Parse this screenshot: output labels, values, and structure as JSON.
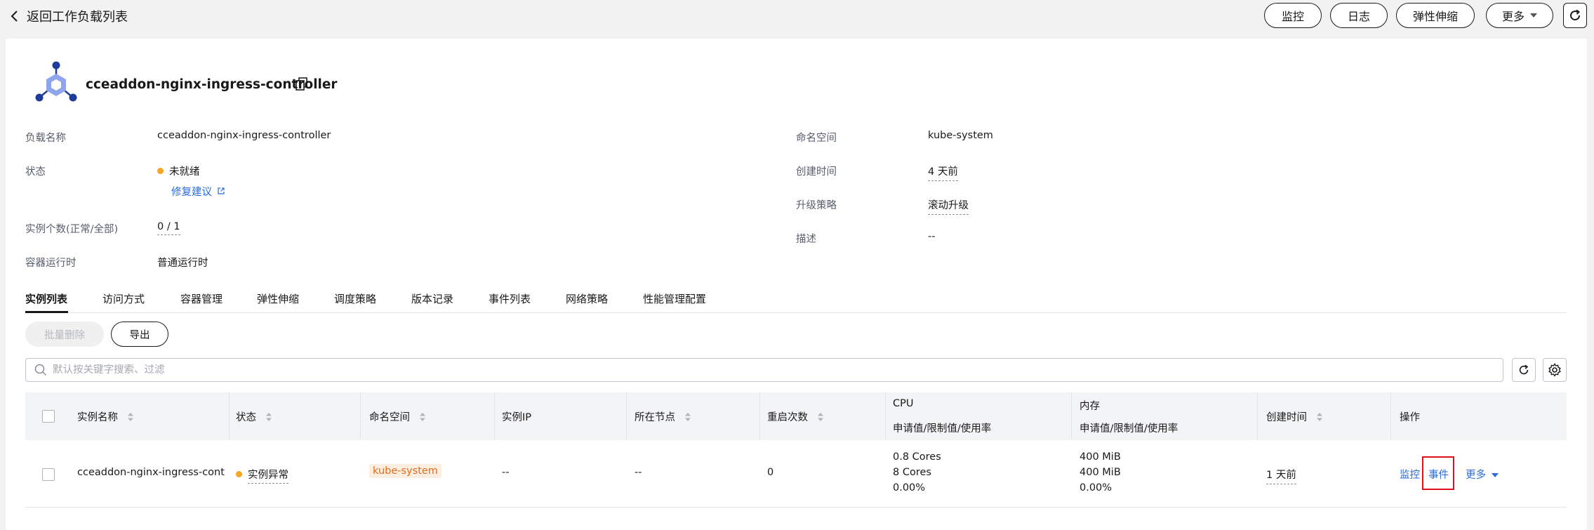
{
  "header": {
    "back_label": "返回工作负载列表",
    "actions": {
      "monitor": "监控",
      "logs": "日志",
      "scaling": "弹性伸缩",
      "more": "更多"
    }
  },
  "workload": {
    "title": "cceaddon-nginx-ingress-controller",
    "details": {
      "name_label": "负载名称",
      "name_value": "cceaddon-nginx-ingress-controller",
      "status_label": "状态",
      "status_value": "未就绪",
      "repair_link": "修复建议",
      "instances_label": "实例个数(正常/全部)",
      "instances_value": "0 / 1",
      "runtime_label": "容器运行时",
      "runtime_value": "普通运行时",
      "namespace_label": "命名空间",
      "namespace_value": "kube-system",
      "created_label": "创建时间",
      "created_value": "4 天前",
      "upgrade_label": "升级策略",
      "upgrade_value": "滚动升级",
      "desc_label": "描述",
      "desc_value": "--"
    }
  },
  "tabs": [
    "实例列表",
    "访问方式",
    "容器管理",
    "弹性伸缩",
    "调度策略",
    "版本记录",
    "事件列表",
    "网络策略",
    "性能管理配置"
  ],
  "toolbar": {
    "batch_delete": "批量删除",
    "export": "导出",
    "search_placeholder": "默认按关键字搜索、过滤"
  },
  "table": {
    "headers": {
      "name": "实例名称",
      "status": "状态",
      "namespace": "命名空间",
      "ip": "实例IP",
      "node": "所在节点",
      "restarts": "重启次数",
      "cpu": "CPU",
      "cpu_sub": "申请值/限制值/使用率",
      "memory": "内存",
      "memory_sub": "申请值/限制值/使用率",
      "created": "创建时间",
      "actions": "操作"
    },
    "rows": [
      {
        "name": "cceaddon-nginx-ingress-controll",
        "status": "实例异常",
        "namespace": "kube-system",
        "ip": "--",
        "node": "--",
        "restarts": "0",
        "cpu": [
          "0.8 Cores",
          "8 Cores",
          "0.00%"
        ],
        "memory": [
          "400 MiB",
          "400 MiB",
          "0.00%"
        ],
        "created": "1 天前",
        "actions": {
          "monitor": "监控",
          "events": "事件",
          "more": "更多"
        }
      }
    ]
  },
  "colors": {
    "accent": "#2a6bd7",
    "warning_dot": "#f5a623",
    "namespace_tag_bg": "#fdeee2",
    "namespace_tag_text": "#e06c1e",
    "highlight": "#e0101a"
  }
}
